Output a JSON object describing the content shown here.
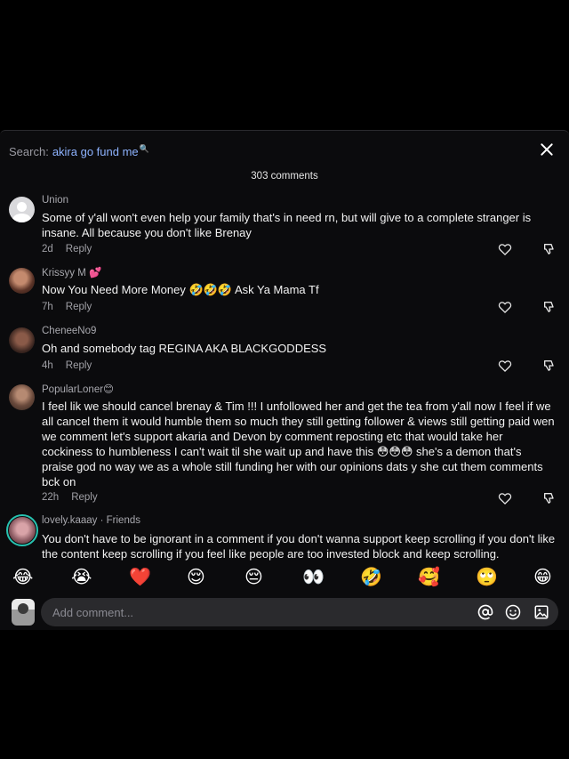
{
  "search": {
    "label": "Search:",
    "query": "akira go fund me",
    "mini_icon": "🔍"
  },
  "comment_count": "303 comments",
  "comments": [
    {
      "username": "Union",
      "text": "Some of y'all won't even help your family that's in need rn, but will give to a complete stranger is insane. All because you don't like Brenay",
      "time": "2d",
      "reply": "Reply",
      "avatar": "default-avatar"
    },
    {
      "username": "Krissyy M 💕",
      "text": "Now You Need More Money 🤣🤣🤣 Ask Ya Mama Tf",
      "time": "7h",
      "reply": "Reply",
      "avatar": "photo"
    },
    {
      "username": "CheneeNo9",
      "text": "Oh and somebody tag REGINA AKA BLACKGODDESS",
      "time": "4h",
      "reply": "Reply",
      "avatar": "photo"
    },
    {
      "username": "PopularLoner😊",
      "text": "I feel lik we should cancel brenay & Tim !!! I unfollowed her and get the tea from y'all now I feel if we all cancel them it would humble them so much they still getting follower & views still getting paid wen we comment let's support akaria and Devon by comment reposting etc that would take her cockiness to humbleness I can't wait til she wait up and have this 😳😳😳 she's a demon that's praise god no way we as a whole still funding her with our opinions dats y she cut them comments bck on",
      "time": "22h",
      "reply": "Reply",
      "avatar": "photo"
    },
    {
      "username": "lovely.kaaay · Friends",
      "text": "You don't have to be ignorant in a comment if you don't wanna support keep scrolling if you don't like the content keep scrolling if you feel like people are too invested block and keep scrolling.",
      "avatar": "photo-story-ring"
    }
  ],
  "emoji_bar": [
    "😂",
    "😭",
    "❤️",
    "😌",
    "😔",
    "👀",
    "🤣",
    "🥰",
    "🙄",
    "😁"
  ],
  "input": {
    "placeholder": "Add comment..."
  },
  "icons": {
    "close": "close-icon",
    "like": "heart-outline-icon",
    "dislike": "thumbs-down-icon",
    "mention": "at-icon",
    "emoji": "smiley-icon",
    "image": "image-icon"
  }
}
